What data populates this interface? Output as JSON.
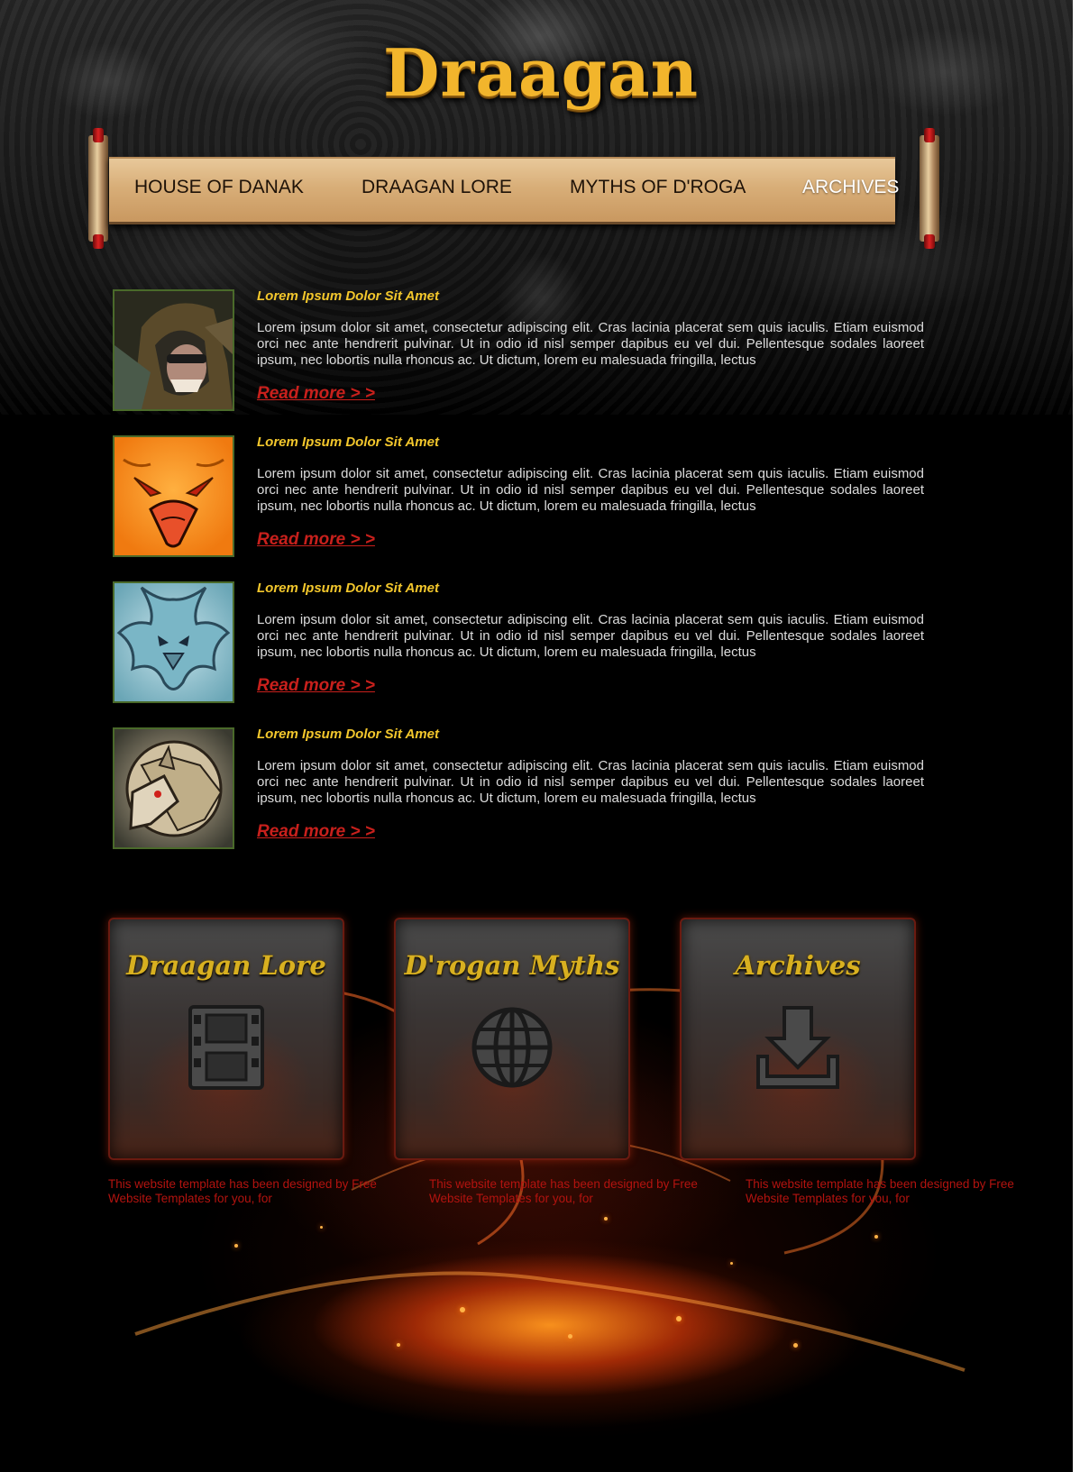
{
  "site": {
    "logo": "Draagan"
  },
  "nav": {
    "items": [
      {
        "label": "HOUSE OF DANAK",
        "active": false
      },
      {
        "label": "DRAAGAN LORE",
        "active": false
      },
      {
        "label": "MYTHS OF D'ROGA",
        "active": false
      },
      {
        "label": "ARCHIVES",
        "active": true
      }
    ]
  },
  "posts": [
    {
      "title": "Lorem Ipsum Dolor Sit Amet",
      "body": "Lorem ipsum dolor sit amet, consectetur adipiscing elit. Cras lacinia placerat sem quis iaculis. Etiam euismod orci nec ante hendrerit pulvinar. Ut in odio id nisl semper dapibus eu vel dui. Pellentesque sodales laoreet ipsum, nec lobortis nulla rhoncus ac. Ut dictum, lorem eu malesuada fringilla, lectus",
      "link": "Read more > >",
      "thumb": "hooded-warrior"
    },
    {
      "title": "Lorem Ipsum Dolor Sit Amet",
      "body": "Lorem ipsum dolor sit amet, consectetur adipiscing elit. Cras lacinia placerat sem quis iaculis. Etiam euismod orci nec ante hendrerit pulvinar. Ut in odio id nisl semper dapibus eu vel dui. Pellentesque sodales laoreet ipsum, nec lobortis nulla rhoncus ac. Ut dictum, lorem eu malesuada fringilla, lectus",
      "link": "Read more > >",
      "thumb": "orange-bird-emblem"
    },
    {
      "title": "Lorem Ipsum Dolor Sit Amet",
      "body": "Lorem ipsum dolor sit amet, consectetur adipiscing elit. Cras lacinia placerat sem quis iaculis. Etiam euismod orci nec ante hendrerit pulvinar. Ut in odio id nisl semper dapibus eu vel dui. Pellentesque sodales laoreet ipsum, nec lobortis nulla rhoncus ac. Ut dictum, lorem eu malesuada fringilla, lectus",
      "link": "Read more > >",
      "thumb": "ice-dragon-emblem"
    },
    {
      "title": "Lorem Ipsum Dolor Sit Amet",
      "body": "Lorem ipsum dolor sit amet, consectetur adipiscing elit. Cras lacinia placerat sem quis iaculis. Etiam euismod orci nec ante hendrerit pulvinar. Ut in odio id nisl semper dapibus eu vel dui. Pellentesque sodales laoreet ipsum, nec lobortis nulla rhoncus ac. Ut dictum, lorem eu malesuada fringilla, lectus",
      "link": "Read more > >",
      "thumb": "boar-emblem"
    }
  ],
  "panels": [
    {
      "title": "Draagan Lore",
      "icon": "film-strip-icon"
    },
    {
      "title": "D'rogan Myths",
      "icon": "globe-icon"
    },
    {
      "title": "Archives",
      "icon": "download-icon"
    }
  ],
  "footer": {
    "notes": [
      "This website template has been designed by Free Website Templates for you, for",
      "This website template has been designed by Free Website Templates for you, for",
      "This website template has been designed by Free Website Templates for you, for"
    ]
  },
  "colors": {
    "title_gold": "#f3c72c",
    "link_red": "#c8201c",
    "body_text": "#dcdcdc",
    "footer_red": "#b3130f"
  }
}
